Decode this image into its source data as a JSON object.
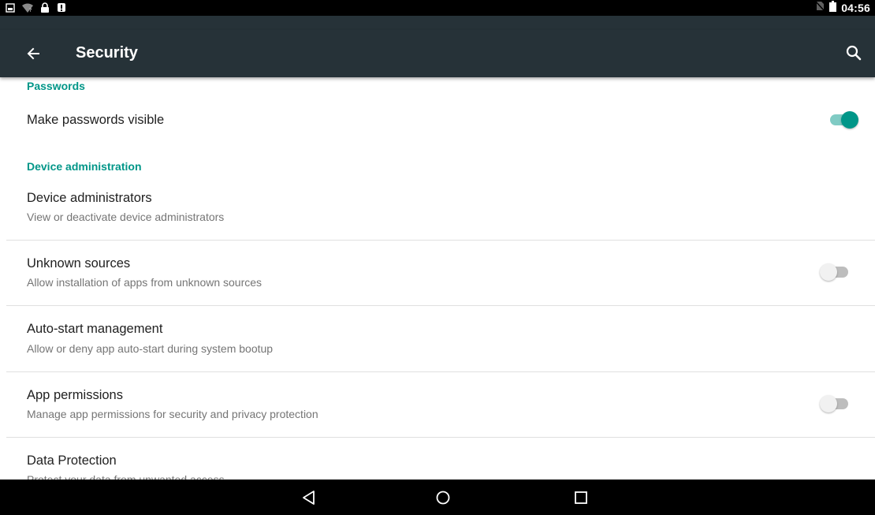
{
  "status_bar": {
    "time": "04:56",
    "icons": [
      "image-icon",
      "wifi-icon",
      "lock-icon",
      "alert-icon",
      "no-sim-icon",
      "battery-icon"
    ]
  },
  "app_bar": {
    "title": "Security",
    "back_icon": "arrow-left-icon",
    "search_icon": "search-icon",
    "color": "#263238"
  },
  "accent_color": "#009688",
  "sections": {
    "passwords": {
      "header": "Passwords",
      "items": [
        {
          "title": "Make passwords visible",
          "toggle": true
        }
      ]
    },
    "device_admin": {
      "header": "Device administration",
      "items": [
        {
          "title": "Device administrators",
          "subtitle": "View or deactivate device administrators"
        },
        {
          "title": "Unknown sources",
          "subtitle": "Allow installation of apps from unknown sources",
          "toggle": false
        },
        {
          "title": "Auto-start management",
          "subtitle": "Allow or deny app auto-start during system bootup"
        },
        {
          "title": "App permissions",
          "subtitle": "Manage app permissions for security and privacy protection",
          "toggle": false
        },
        {
          "title": "Data Protection",
          "subtitle": "Protect your data from unwanted access"
        }
      ]
    }
  },
  "nav_bar": {
    "buttons": [
      "back-triangle-icon",
      "home-circle-icon",
      "recents-square-icon"
    ]
  }
}
